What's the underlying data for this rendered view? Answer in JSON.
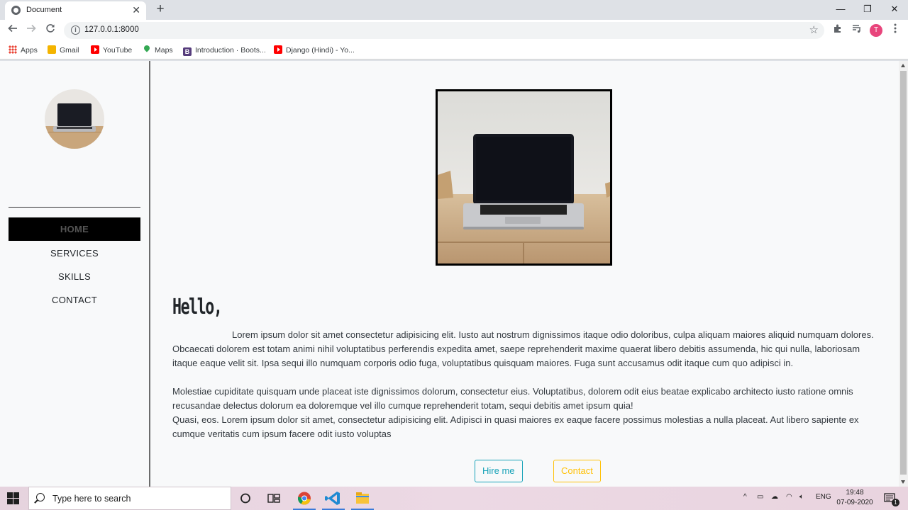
{
  "browser": {
    "tab_title": "Document",
    "tab_close": "✕",
    "new_tab": "+",
    "url": "127.0.0.1:8000",
    "profile_initial": "T",
    "controls": {
      "minimize": "—",
      "maximize": "❐",
      "close": "✕"
    }
  },
  "bookmarks": [
    {
      "label": "Apps",
      "icon": "apps-icon"
    },
    {
      "label": "Gmail",
      "icon": "gmail-icon"
    },
    {
      "label": "YouTube",
      "icon": "youtube-icon"
    },
    {
      "label": "Maps",
      "icon": "maps-icon"
    },
    {
      "label": "Introduction · Boots...",
      "icon": "bootstrap-icon"
    },
    {
      "label": "Django (Hindi) - Yo...",
      "icon": "youtube-icon"
    }
  ],
  "sidebar": {
    "nav": [
      {
        "label": "HOME",
        "active": true
      },
      {
        "label": "SERVICES",
        "active": false
      },
      {
        "label": "SKILLS",
        "active": false
      },
      {
        "label": "CONTACT",
        "active": false
      }
    ]
  },
  "main": {
    "greeting": "Hello,",
    "paragraph1": "Lorem ipsum dolor sit amet consectetur adipisicing elit. Iusto aut nostrum dignissimos itaque odio doloribus, culpa aliquam maiores aliquid numquam dolores. Obcaecati dolorem est totam animi nihil voluptatibus perferendis expedita amet, saepe reprehenderit maxime quaerat libero debitis assumenda, hic qui nulla, laboriosam itaque eaque velit sit. Ipsa sequi illo numquam corporis odio fuga, voluptatibus quisquam maiores. Fuga sunt accusamus odit itaque cum quo adipisci in.",
    "paragraph2": "Molestiae cupiditate quisquam unde placeat iste dignissimos dolorum, consectetur eius. Voluptatibus, dolorem odit eius beatae explicabo architecto iusto ratione omnis recusandae delectus dolorum ea doloremque vel illo cumque reprehenderit totam, sequi debitis amet ipsum quia!",
    "paragraph3": "Quasi, eos. Lorem ipsum dolor sit amet, consectetur adipisicing elit. Adipisci in quasi maiores ex eaque facere possimus molestias a nulla placeat. Aut libero sapiente ex cumque veritatis cum ipsum facere odit iusto voluptas",
    "hire_button": "Hire me",
    "contact_button": "Contact"
  },
  "taskbar": {
    "search_placeholder": "Type here to search",
    "language": "ENG",
    "time": "19:48",
    "date": "07-09-2020",
    "notification_count": "1"
  },
  "colors": {
    "accent_info": "#17a2b8",
    "accent_warning": "#ffc107",
    "profile": "#e8457c"
  }
}
